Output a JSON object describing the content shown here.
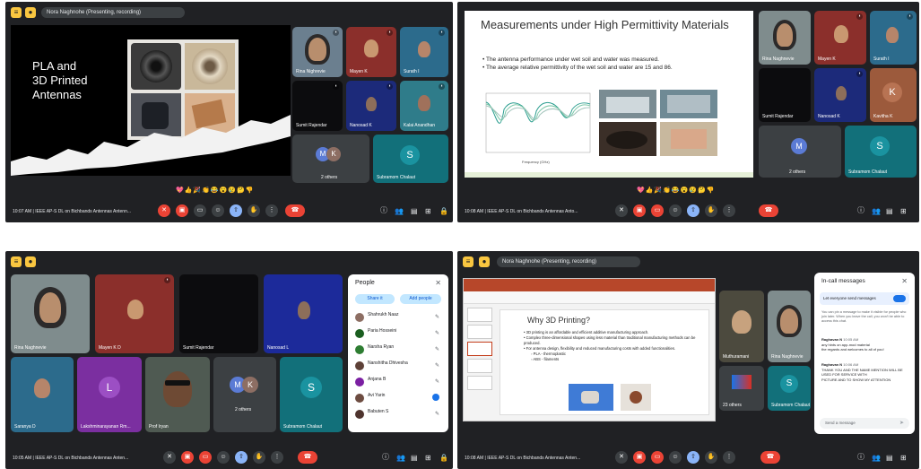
{
  "colors": {
    "meet_bg": "#202124",
    "accent_yellow": "#f9c640",
    "end_red": "#ea4335",
    "active_blue": "#8ab4f8",
    "toggle_blue": "#1a73e8"
  },
  "q1": {
    "present_chip": "Nora Naghnohe (Presenting, recording)",
    "slide_title_l1": "PLA and",
    "slide_title_l2": "3D Printed",
    "slide_title_l3": "Antennas",
    "tiles": [
      {
        "name": "Rina Nighrevie"
      },
      {
        "name": "Mayen K"
      },
      {
        "name": "Surath I"
      },
      {
        "name": "Sumit Rajendar"
      },
      {
        "name": "Nanosad K"
      },
      {
        "name": "Kalai Anandhan"
      },
      {
        "name": "2 others",
        "initials": "MK"
      },
      {
        "name": "Subramom Chalaut",
        "initial": "S"
      }
    ],
    "time": "10:07 AM | IEEE AP-S DL on Bichbands Antennas Antenn..."
  },
  "q2": {
    "slide_title": "Measurements under High Permittivity Materials",
    "bullet1": "The antenna performance under wet soil and water was measured.",
    "bullet2": "The average relative permittivity of the wet soil and water are 15 and 86.",
    "xlabel": "Frequency (GHz)",
    "tiles": [
      {
        "name": "Rina Naghnevie"
      },
      {
        "name": "Mayen K"
      },
      {
        "name": "Surath I"
      },
      {
        "name": "Sumit Rajendar"
      },
      {
        "name": "Nanosad K"
      },
      {
        "name": "Kavitha K",
        "initial": "K"
      },
      {
        "name": "2 others",
        "initials": "M"
      },
      {
        "name": "Subramom Chalaut",
        "initial": "S"
      }
    ],
    "time": "10:08 AM | IEEE AP-S DL on Bichbands Antennas Anto..."
  },
  "q3": {
    "tiles": [
      {
        "name": "Rina Naghnevie"
      },
      {
        "name": "Mayen K D"
      },
      {
        "name": "Sumit Rajendar"
      },
      {
        "name": "Nanosad L"
      },
      {
        "name": "Saranya D"
      },
      {
        "name": "Lakshminarayanan Rm...",
        "initial": "L"
      },
      {
        "name": "Prof Iryan"
      },
      {
        "name": "2 others",
        "initials": "MK"
      },
      {
        "name": "Subramom Chalaut",
        "initial": "S"
      }
    ],
    "people": {
      "title": "People",
      "btn_share": "Share it",
      "btn_add": "Add people",
      "list": [
        "Shahrukh Naaz",
        "Paria Hosseini",
        "Narsha Ryan",
        "Nanshitha Dhivesha",
        "Anjana B",
        "Avi Yarin",
        "Babuten S"
      ]
    },
    "time": "10:05 AM | IEEE AP-S DL on Bichbands Antennas Anten..."
  },
  "q4": {
    "present_chip": "Nora Naghnohe (Presenting, recording)",
    "slide_title": "Why 3D Printing?",
    "bullets": [
      "3D printing is an affordable and efficient additive manufacturing approach.",
      "Complex three-dimensional shapes using less material than traditional manufacturing methods can be produced.",
      "For antenna design, flexibility and reduced manufacturing costs with added functionalities.",
      "PLA - thermoplastic",
      "ABS - filaments"
    ],
    "tiles": [
      {
        "name": "Muthuramani"
      },
      {
        "name": "Rina Naghnevie"
      },
      {
        "name": "23 others"
      },
      {
        "name": "Subramom Chalaut",
        "initial": "S"
      }
    ],
    "chat": {
      "title": "In-call messages",
      "toggle_label": "Let everyone send messages",
      "notice": "You can pin a message to make it visible for people who join later. When you leave the call, you won't be able to access this chat.",
      "msg1_author": "Raghavan N",
      "msg1_time": "10:05 AM",
      "msg1_text": "any hints on app-mod material",
      "msg1_text2": "the regards and welcomes to all of you!",
      "msg2_author": "Raghavan N",
      "msg2_time": "10:06 AM",
      "msg2_text": "THANK YOU AND THE NAME MENTION WILL BE USED FOR SERVICE WITH",
      "msg2_text2": "PICTURE AND TO SHOW MY ATTENTION",
      "input_placeholder": "Send a message"
    },
    "time": "10:08 AM | IEEE AP-S DL on Bichbands Antennas Anten..."
  },
  "reactions": "💖👍🎉👏😂😮😢🤔👎"
}
